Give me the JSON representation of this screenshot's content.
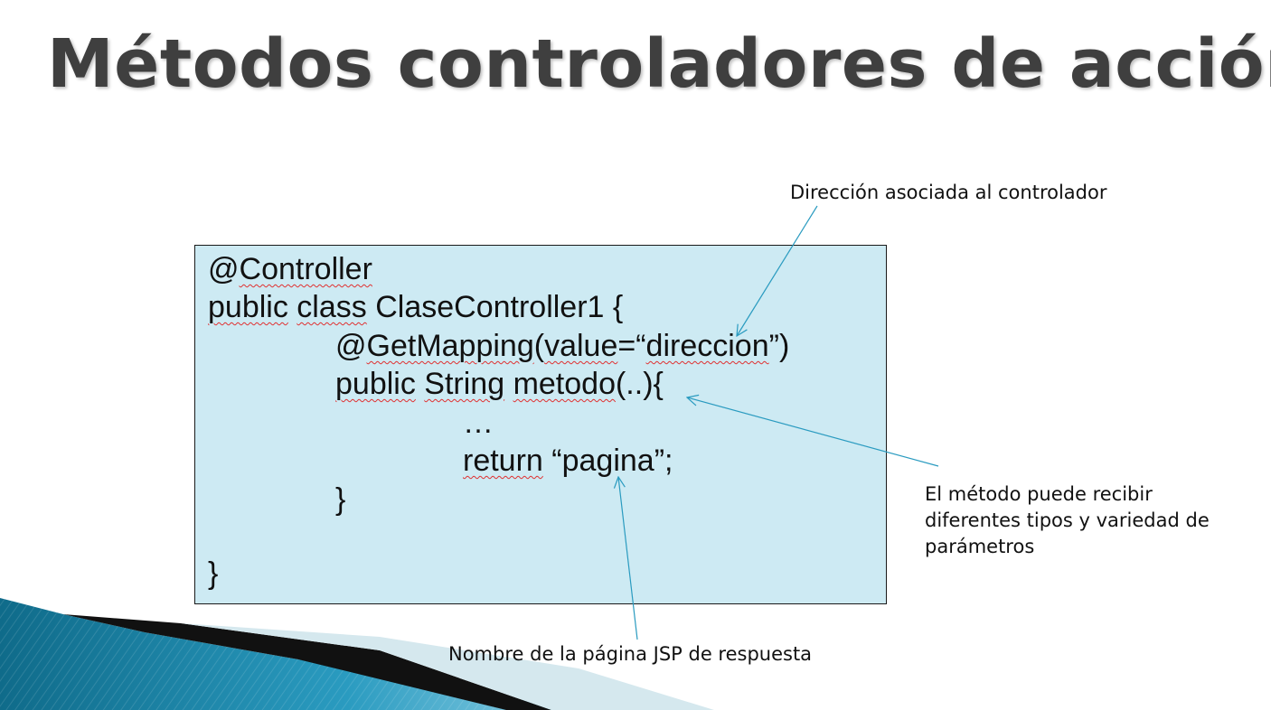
{
  "slide": {
    "title": "Métodos controladores de acción"
  },
  "code": {
    "line1": {
      "t0": "@",
      "t1": "Controller"
    },
    "line2": {
      "t0": "public",
      "t1": " ",
      "t2": "class",
      "t3": " ClaseController1 {"
    },
    "line3": {
      "t0": "@",
      "t1": "GetMapping",
      "t2": "(",
      "t3": "value",
      "t4": "=“",
      "t5": "direccion",
      "t6": "”)"
    },
    "line4": {
      "t0": "public",
      "t1": " ",
      "t2": "String",
      "t3": " ",
      "t4": "metodo",
      "t5": "(..){"
    },
    "line5": "…",
    "line6": {
      "t0": "return",
      "t1": " “pagina”;"
    },
    "line7": "}",
    "line8": "}"
  },
  "notes": {
    "direccion": "Dirección asociada al controlador",
    "parametros_1": "El método puede recibir",
    "parametros_2": "diferentes tipos y variedad de",
    "parametros_3": "parámetros",
    "pagina": "Nombre de la página JSP de respuesta"
  },
  "colors": {
    "code_background": "#cdeaf3",
    "arrow": "#2a9bc0",
    "title": "#3f3f3f",
    "decor_teal": "#1b7fa0"
  }
}
